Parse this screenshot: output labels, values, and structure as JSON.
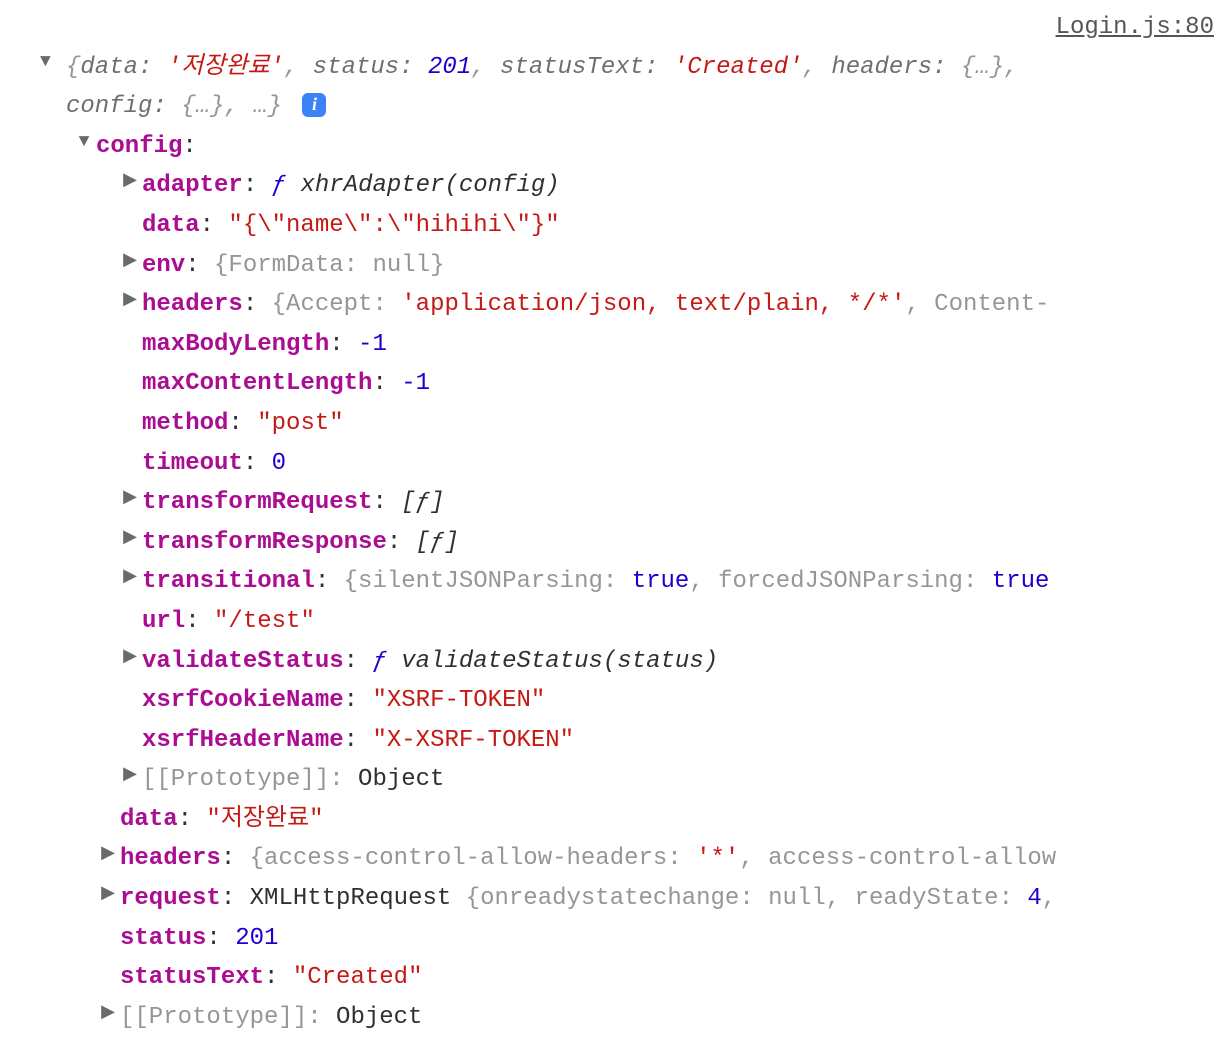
{
  "source": "Login.js:80",
  "summary": {
    "data_k": "data:",
    "data_v": "'저장완료'",
    "status_k": "status:",
    "status_v": "201",
    "statusText_k": "statusText:",
    "statusText_v": "'Created'",
    "headers_k": "headers:",
    "headers_v": "{…}",
    "config_k": "config:",
    "config_v": "{…}",
    "ellipsis": "…"
  },
  "tree": {
    "config_label": "config",
    "adapter_k": "adapter",
    "adapter_f": "ƒ",
    "adapter_sig": "xhrAdapter(config)",
    "cfg_data_k": "data",
    "cfg_data_v": "\"{\\\"name\\\":\\\"hihihi\\\"}\"",
    "env_k": "env",
    "env_open": "{FormData:",
    "env_val": "null",
    "env_close": "}",
    "cfg_headers_k": "headers",
    "cfg_headers_open": "{Accept:",
    "cfg_headers_val": "'application/json, text/plain, */*'",
    "cfg_headers_tail": ", Content-",
    "maxBodyLength_k": "maxBodyLength",
    "maxBodyLength_v": "-1",
    "maxContentLength_k": "maxContentLength",
    "maxContentLength_v": "-1",
    "method_k": "method",
    "method_v": "\"post\"",
    "timeout_k": "timeout",
    "timeout_v": "0",
    "transformRequest_k": "transformRequest",
    "transformRequest_v": "[ƒ]",
    "transformResponse_k": "transformResponse",
    "transformResponse_v": "[ƒ]",
    "transitional_k": "transitional",
    "transitional_open": "{silentJSONParsing:",
    "transitional_v1": "true",
    "transitional_mid": ", forcedJSONParsing:",
    "transitional_v2": "true",
    "url_k": "url",
    "url_v": "\"/test\"",
    "validateStatus_k": "validateStatus",
    "validateStatus_f": "ƒ",
    "validateStatus_sig": "validateStatus(status)",
    "xsrfCookieName_k": "xsrfCookieName",
    "xsrfCookieName_v": "\"XSRF-TOKEN\"",
    "xsrfHeaderName_k": "xsrfHeaderName",
    "xsrfHeaderName_v": "\"X-XSRF-TOKEN\"",
    "proto_k": "[[Prototype]]",
    "proto_v": "Object",
    "data_k": "data",
    "data_v": "\"저장완료\"",
    "headers_k": "headers",
    "headers_open": "{access-control-allow-headers:",
    "headers_v": "'*'",
    "headers_tail": ", access-control-allow",
    "request_k": "request",
    "request_open": "XMLHttpRequest",
    "request_mid1": "{onreadystatechange:",
    "request_v1": "null",
    "request_mid2": ", readyState:",
    "request_v2": "4",
    "request_tail": ",",
    "status_k": "status",
    "status_v": "201",
    "statusText_k": "statusText",
    "statusText_v": "\"Created\"",
    "proto2_k": "[[Prototype]]",
    "proto2_v": "Object",
    "colon": ":"
  },
  "glyphs": {
    "down": "▼",
    "right": "▶",
    "info": "i"
  }
}
